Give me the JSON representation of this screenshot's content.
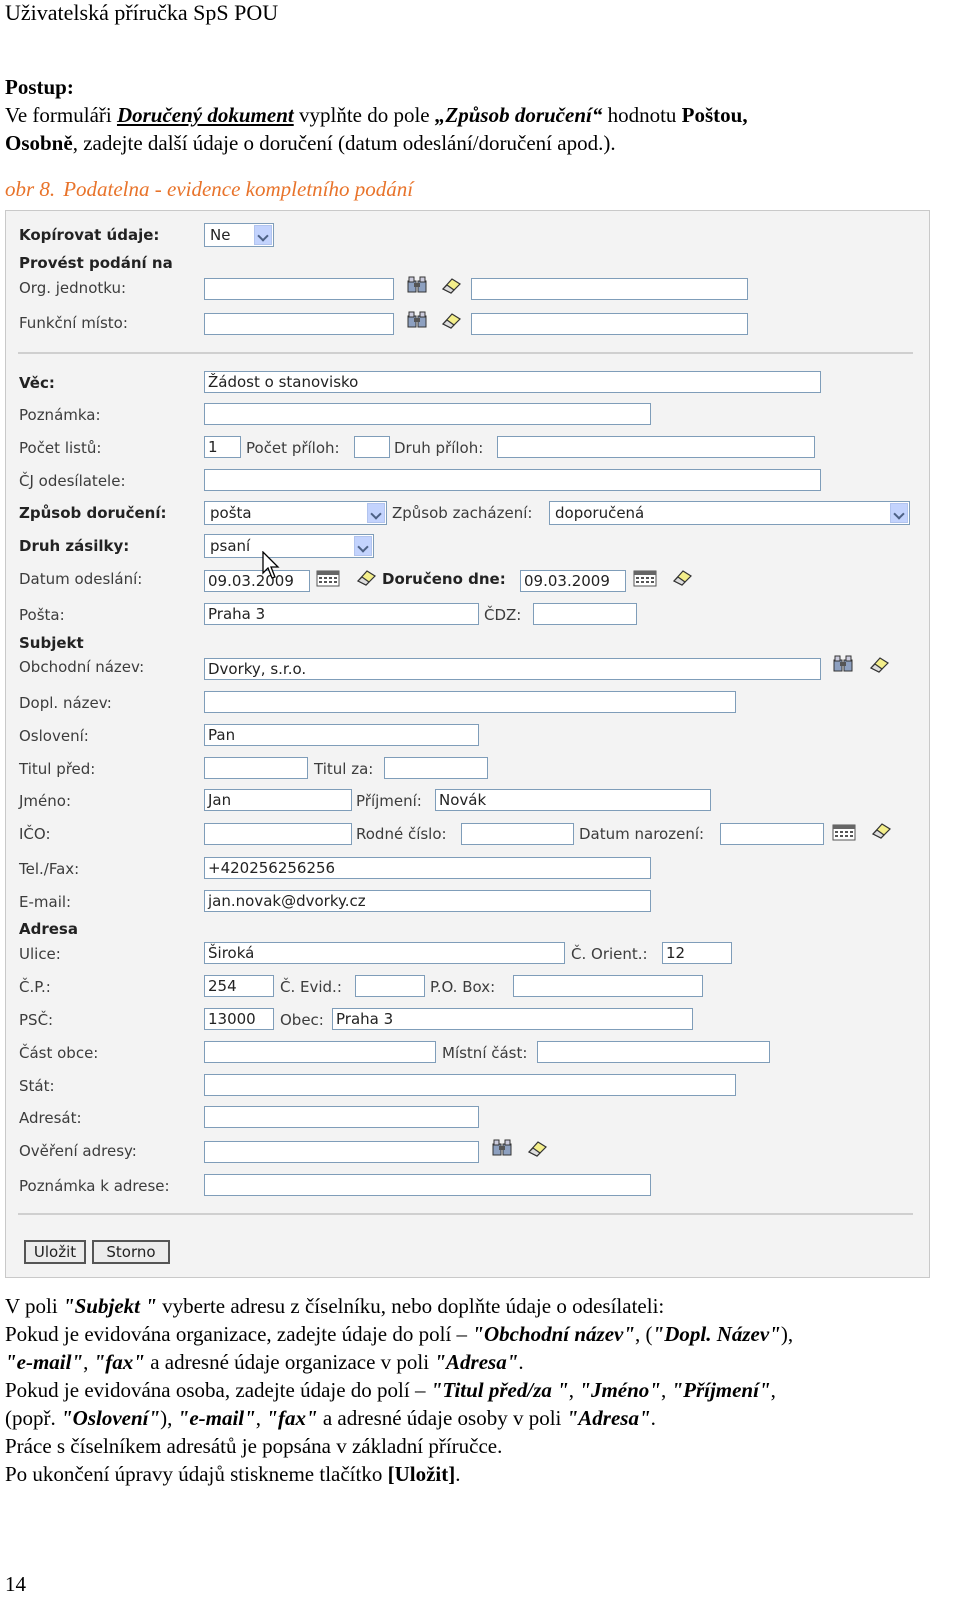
{
  "header": "Uživatelská příručka SpS POU",
  "postup": {
    "title": "Postup:",
    "line1_a": "Ve formuláři ",
    "line1_b": "Doručený dokument",
    "line1_c": " vyplňte do pole ",
    "line1_d": "„Způsob doručení“",
    "line1_e": " hodnotu ",
    "line1_f": "Poštou,",
    "line2_a": "Osobně",
    "line2_b": ", zadejte další údaje o doručení (datum odeslání/doručení apod.)."
  },
  "caption": {
    "label": "obr 8.",
    "text": "Podatelna - evidence kompletního podání"
  },
  "form": {
    "kopirovat_label": "Kopírovat údaje:",
    "kopirovat_value": "Ne",
    "provest_label": "Provést podání na",
    "org_label": "Org. jednotku:",
    "funkcni_label": "Funkční místo:",
    "vec_label": "Věc:",
    "vec_value": "Žádost o stanovisko",
    "poznamka_label": "Poznámka:",
    "pocet_listu_label": "Počet listů:",
    "pocet_listu_value": "1",
    "pocet_priloh_label": "Počet příloh:",
    "druh_priloh_label": "Druh příloh:",
    "cj_label": "ČJ odesílatele:",
    "zpusob_label": "Způsob doručení:",
    "zpusob_value": "pošta",
    "zachazeni_label": "Způsob zacházení:",
    "zachazeni_value": "doporučená",
    "druh_zasilky_label": "Druh zásilky:",
    "druh_zasilky_value": "psaní",
    "datum_odeslani_label": "Datum odeslání:",
    "datum_odeslani_value": "09.03.2009",
    "doruceno_label": "Doručeno dne:",
    "doruceno_value": "09.03.2009",
    "posta_label": "Pošta:",
    "posta_value": "Praha 3",
    "cdz_label": "ČDZ:",
    "subjekt_label": "Subjekt",
    "obchodni_label": "Obchodní název:",
    "obchodni_value": "Dvorky, s.r.o.",
    "dopl_label": "Dopl. název:",
    "osloveni_label": "Oslovení:",
    "osloveni_value": "Pan",
    "titul_pred_label": "Titul před:",
    "titul_za_label": "Titul za:",
    "jmeno_label": "Jméno:",
    "jmeno_value": "Jan",
    "prijmeni_label": "Příjmení:",
    "prijmeni_value": "Novák",
    "ico_label": "IČO:",
    "rodne_label": "Rodné číslo:",
    "narozeni_label": "Datum narození:",
    "tel_label": "Tel./Fax:",
    "tel_value": "+420256256256",
    "email_label": "E-mail:",
    "email_value": "jan.novak@dvorky.cz",
    "adresa_label": "Adresa",
    "ulice_label": "Ulice:",
    "ulice_value": "Široká",
    "orient_label": "Č. Orient.:",
    "orient_value": "12",
    "cp_label": "Č.P.:",
    "cp_value": "254",
    "evid_label": "Č. Evid.:",
    "pobox_label": "P.O. Box:",
    "psc_label": "PSČ:",
    "psc_value": "13000",
    "obec_label": "Obec:",
    "obec_value": "Praha 3",
    "cast_obce_label": "Část obce:",
    "mistni_label": "Místní část:",
    "stat_label": "Stát:",
    "adresat_label": "Adresát:",
    "overeni_label": "Ověření adresy:",
    "pozn_adresa_label": "Poznámka k adrese:",
    "ulozit_label": "Uložit",
    "storno_label": "Storno"
  },
  "body": {
    "p1_a": "V poli ",
    "p1_b": "\"Subjekt \"",
    "p1_c": " vyberte adresu z číselníku, nebo doplňte údaje o odesílateli:",
    "p2_a": "Pokud je evidována organizace, zadejte údaje do polí – ",
    "p2_b": "\"Obchodní název\"",
    "p2_c": ", (",
    "p2_d": "\"Dopl. Název\"",
    "p2_e": "),",
    "p3_a": "\"e-mail\"",
    "p3_b": ", ",
    "p3_c": "\"fax\"",
    "p3_d": " a adresné údaje organizace v poli ",
    "p3_e": "\"Adresa\"",
    "p3_f": ".",
    "p4_a": "Pokud je evidována osoba, zadejte údaje do polí – ",
    "p4_b": "\"Titul před/za \"",
    "p4_c": ", ",
    "p4_d": "\"Jméno\"",
    "p4_e": ", ",
    "p4_f": "\"Příjmení\"",
    "p4_g": ",",
    "p5_a": "(popř. ",
    "p5_b": "\"Oslovení\"",
    "p5_c": "), ",
    "p5_d": "\"e-mail\"",
    "p5_e": ", ",
    "p5_f": "\"fax\"",
    "p5_g": " a adresné údaje osoby v poli ",
    "p5_h": "\"Adresa\"",
    "p5_i": ".",
    "p6": "Práce s číselníkem adresátů je popsána v základní příručce.",
    "p7_a": "Po ukončení úpravy údajů stiskneme tlačítko ",
    "p7_b": "[Uložit]",
    "p7_c": "."
  },
  "page_number": "14"
}
